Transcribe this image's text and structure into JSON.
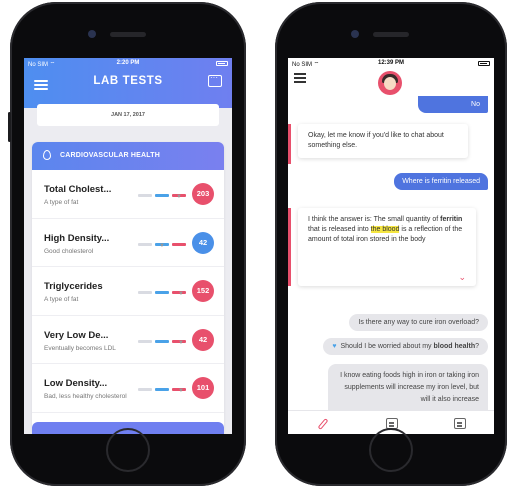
{
  "left_phone": {
    "status": {
      "carrier": "No SIM ⌔",
      "time": "2:20 PM"
    },
    "header": {
      "title": "LAB TESTS"
    },
    "date_label": "JAN 17, 2017",
    "section": {
      "title": "CARDIOVASCULAR HEALTH"
    },
    "tests": [
      {
        "name": "Total Cholest...",
        "desc": "A type of fat",
        "value": "203",
        "color": "#e8506c"
      },
      {
        "name": "High Density...",
        "desc": "Good cholesterol",
        "value": "42",
        "color": "#4a90e8"
      },
      {
        "name": "Triglycerides",
        "desc": "A type of fat",
        "value": "152",
        "color": "#e8506c"
      },
      {
        "name": "Very Low De...",
        "desc": "Eventually becomes LDL",
        "value": "42",
        "color": "#e8506c"
      },
      {
        "name": "Low Density...",
        "desc": "Bad, less healthy cholesterol",
        "value": "101",
        "color": "#e8506c"
      }
    ]
  },
  "right_phone": {
    "status": {
      "carrier": "No SIM ⌔",
      "time": "12:39 PM"
    },
    "messages": {
      "user_no": "No",
      "bot_1": "Okay, let me know if you'd like to chat about something else.",
      "user_where": "Where is ferritin released",
      "bot_answer": {
        "p1": "I think the answer is: The small quantity of ",
        "bold1": "ferritin",
        "p2": " that is released into ",
        "highlight": "the blood",
        "p3": " is a reflection of the amount of total iron stored in the body"
      }
    },
    "suggestions": {
      "s1": "Is there any way to cure iron overload?",
      "s2_prefix": "Should I be worried about my ",
      "s2_bold": "blood health",
      "s2_suffix": "?"
    },
    "reply_snippet": "I know eating foods high in iron or taking iron supplements will increase my iron level, but will it also increase"
  },
  "colors": {
    "accent_blue": "#4f74df",
    "accent_red": "#e8506c"
  }
}
